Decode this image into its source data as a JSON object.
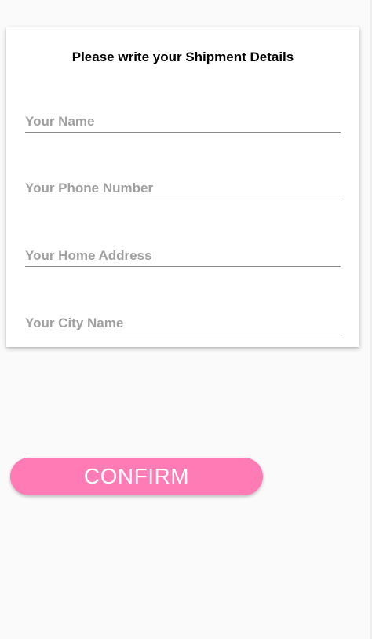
{
  "form": {
    "title": "Please write your Shipment Details",
    "fields": [
      {
        "placeholder": "Your Name",
        "value": ""
      },
      {
        "placeholder": "Your Phone Number",
        "value": ""
      },
      {
        "placeholder": "Your Home Address",
        "value": ""
      },
      {
        "placeholder": "Your City Name",
        "value": ""
      }
    ]
  },
  "confirm": {
    "label": "CONFIRM",
    "color": "#ff7bb5"
  }
}
